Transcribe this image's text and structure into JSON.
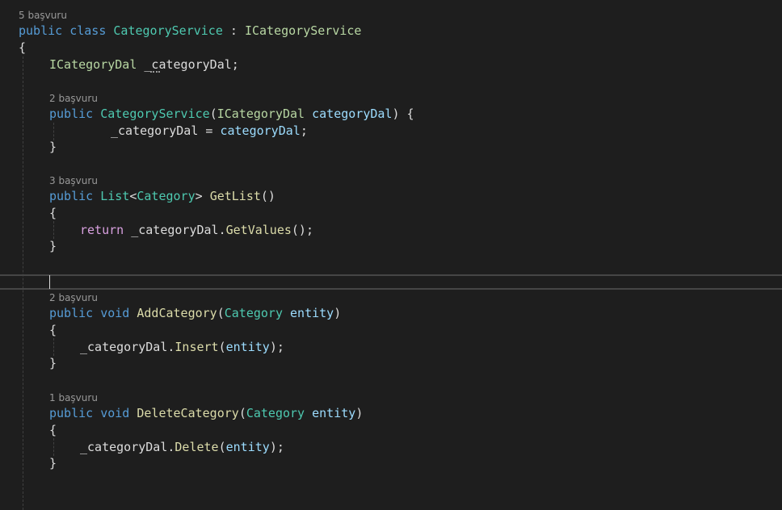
{
  "colors": {
    "keyword": "#569cd6",
    "type": "#4ec9b0",
    "interface": "#b8d7a3",
    "method": "#dcdcaa",
    "param": "#9cdcfe",
    "control": "#d8a0df",
    "default": "#dcdcdc",
    "codelens": "#999999"
  },
  "codelens": {
    "class_refs": "5 başvuru",
    "ctor_refs": "2 başvuru",
    "getlist_refs": "3 başvuru",
    "add_refs": "2 başvuru",
    "delete_refs": "1 başvuru"
  },
  "code": {
    "class_decl": [
      {
        "t": "public",
        "k": "keyword"
      },
      {
        "t": " "
      },
      {
        "t": "class",
        "k": "keyword"
      },
      {
        "t": " "
      },
      {
        "t": "CategoryService",
        "k": "type"
      },
      {
        "t": " : "
      },
      {
        "t": "ICategoryService",
        "k": "interface"
      }
    ],
    "class_open": [
      {
        "t": "{"
      }
    ],
    "field_decl": [
      {
        "t": "ICategoryDal",
        "k": "interface"
      },
      {
        "t": " _categoryDal;"
      }
    ],
    "ctor_sig": [
      {
        "t": "public",
        "k": "keyword"
      },
      {
        "t": " "
      },
      {
        "t": "CategoryService",
        "k": "type"
      },
      {
        "t": "("
      },
      {
        "t": "ICategoryDal",
        "k": "interface"
      },
      {
        "t": " "
      },
      {
        "t": "categoryDal",
        "k": "param"
      },
      {
        "t": ") {"
      }
    ],
    "ctor_body": [
      {
        "t": "_categoryDal = "
      },
      {
        "t": "categoryDal",
        "k": "param"
      },
      {
        "t": ";"
      }
    ],
    "ctor_close": [
      {
        "t": "}"
      }
    ],
    "getlist_sig": [
      {
        "t": "public",
        "k": "keyword"
      },
      {
        "t": " "
      },
      {
        "t": "List",
        "k": "type"
      },
      {
        "t": "<"
      },
      {
        "t": "Category",
        "k": "type"
      },
      {
        "t": "> "
      },
      {
        "t": "GetList",
        "k": "method"
      },
      {
        "t": "()"
      }
    ],
    "getlist_open": [
      {
        "t": "{"
      }
    ],
    "getlist_body": [
      {
        "t": "return",
        "k": "control"
      },
      {
        "t": " _categoryDal."
      },
      {
        "t": "GetValues",
        "k": "method"
      },
      {
        "t": "();"
      }
    ],
    "getlist_close": [
      {
        "t": "}"
      }
    ],
    "add_sig": [
      {
        "t": "public",
        "k": "keyword"
      },
      {
        "t": " "
      },
      {
        "t": "void",
        "k": "keyword"
      },
      {
        "t": " "
      },
      {
        "t": "AddCategory",
        "k": "method"
      },
      {
        "t": "("
      },
      {
        "t": "Category",
        "k": "type"
      },
      {
        "t": " "
      },
      {
        "t": "entity",
        "k": "param"
      },
      {
        "t": ")"
      }
    ],
    "add_open": [
      {
        "t": "{"
      }
    ],
    "add_body": [
      {
        "t": "_categoryDal."
      },
      {
        "t": "Insert",
        "k": "method"
      },
      {
        "t": "("
      },
      {
        "t": "entity",
        "k": "param"
      },
      {
        "t": ");"
      }
    ],
    "add_close": [
      {
        "t": "}"
      }
    ],
    "delete_sig": [
      {
        "t": "public",
        "k": "keyword"
      },
      {
        "t": " "
      },
      {
        "t": "void",
        "k": "keyword"
      },
      {
        "t": " "
      },
      {
        "t": "DeleteCategory",
        "k": "method"
      },
      {
        "t": "("
      },
      {
        "t": "Category",
        "k": "type"
      },
      {
        "t": " "
      },
      {
        "t": "entity",
        "k": "param"
      },
      {
        "t": ")"
      }
    ],
    "delete_open": [
      {
        "t": "{"
      }
    ],
    "delete_body": [
      {
        "t": "_categoryDal."
      },
      {
        "t": "Delete",
        "k": "method"
      },
      {
        "t": "("
      },
      {
        "t": "entity",
        "k": "param"
      },
      {
        "t": ");"
      }
    ],
    "delete_close": [
      {
        "t": "}"
      }
    ]
  }
}
